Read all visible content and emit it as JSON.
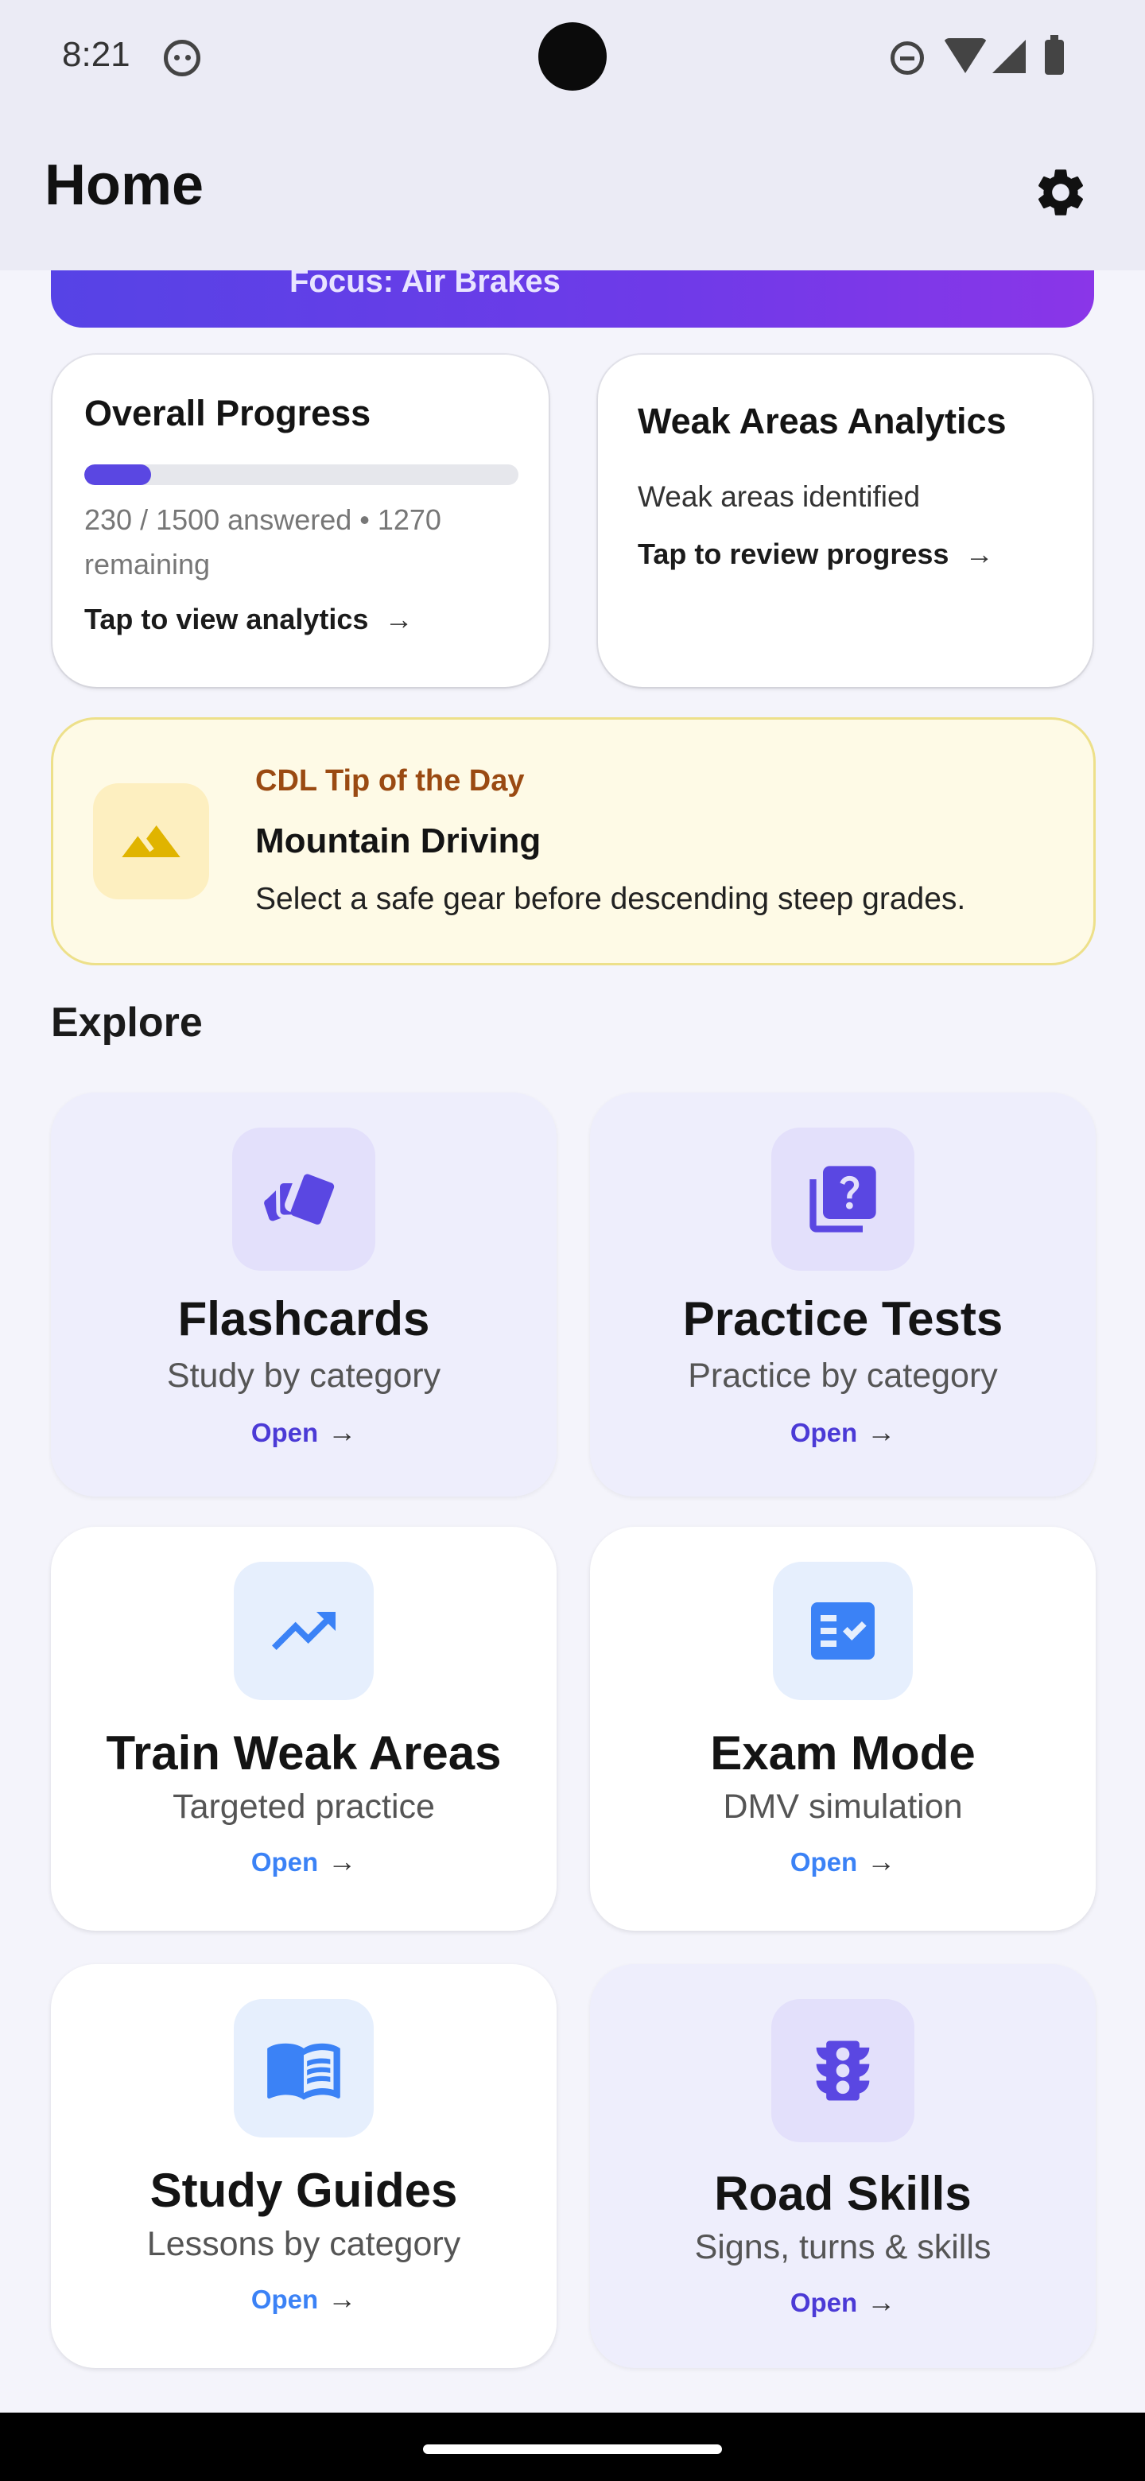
{
  "status_bar": {
    "time": "8:21"
  },
  "app_bar": {
    "title": "Home",
    "settings_icon": "gear-icon"
  },
  "banner": {
    "text": "Focus: Air Brakes"
  },
  "overall_progress": {
    "title": "Overall Progress",
    "progress_fraction": 0.153,
    "summary": "230 / 1500 answered • 1270 remaining",
    "link_label": "Tap to view analytics"
  },
  "weak_areas": {
    "title": "Weak Areas Analytics",
    "subtitle": "Weak areas identified",
    "link_label": "Tap to review progress"
  },
  "tip": {
    "kicker": "CDL Tip of the Day",
    "title": "Mountain Driving",
    "text": "Select a safe gear before descending steep grades.",
    "icon": "mountain-icon"
  },
  "explore": {
    "title": "Explore",
    "tiles": [
      {
        "title": "Flashcards",
        "subtitle": "Study by category",
        "action": "Open",
        "icon": "cards-icon"
      },
      {
        "title": "Practice Tests",
        "subtitle": "Practice by category",
        "action": "Open",
        "icon": "quiz-icon"
      },
      {
        "title": "Train Weak Areas",
        "subtitle": "Targeted practice",
        "action": "Open",
        "icon": "trending-up-icon"
      },
      {
        "title": "Exam Mode",
        "subtitle": "DMV simulation",
        "action": "Open",
        "icon": "checklist-icon"
      },
      {
        "title": "Study Guides",
        "subtitle": "Lessons by category",
        "action": "Open",
        "icon": "book-icon"
      },
      {
        "title": "Road Skills",
        "subtitle": "Signs, turns & skills",
        "action": "Open",
        "icon": "traffic-light-icon"
      }
    ]
  },
  "colors": {
    "accent_purple": "#5a47e2",
    "accent_blue": "#3b82f6",
    "tip_background": "#fefae6",
    "tip_kicker": "#9a4a12"
  }
}
